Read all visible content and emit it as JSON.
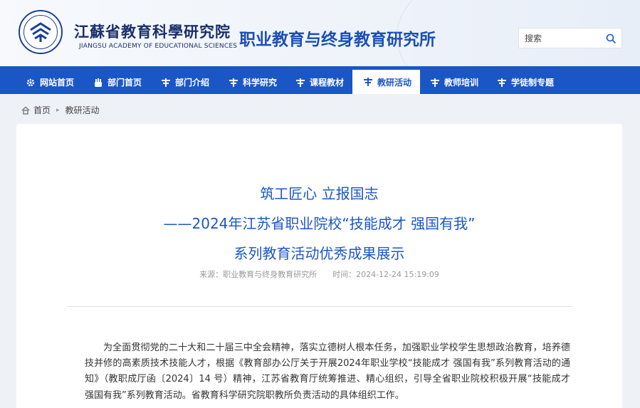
{
  "header": {
    "logo_cn": "江蘇省教育科學研究院",
    "logo_en": "JIANGSU ACADEMY OF EDUCATIONAL SCIENCES",
    "site_title": "职业教育与终身教育研究所",
    "search_placeholder": "搜索"
  },
  "nav": {
    "items": [
      {
        "label": "网站首页",
        "icon": "gear-icon"
      },
      {
        "label": "部门首页",
        "icon": "hand-icon"
      },
      {
        "label": "部门介绍",
        "icon": "tee-icon"
      },
      {
        "label": "科学研究",
        "icon": "tee-icon"
      },
      {
        "label": "课程教材",
        "icon": "tee-icon"
      },
      {
        "label": "教研活动",
        "icon": "tee-icon",
        "active": true
      },
      {
        "label": "教师培训",
        "icon": "tee-icon"
      },
      {
        "label": "学徒制专题",
        "icon": "tee-icon"
      }
    ]
  },
  "breadcrumb": {
    "home": "首页",
    "current": "教研活动"
  },
  "article": {
    "title_line1": "筑工匠心 立报国志",
    "title_line2": "——2024年江苏省职业院校“技能成才 强国有我”",
    "title_line3": "系列教育活动优秀成果展示",
    "source": "来源：职业教育与终身教育研究所",
    "time": "时间：2024-12-24 15:19:09",
    "paragraph": "为全面贯彻党的二十大和二十届三中全会精神，落实立德树人根本任务，加强职业学校学生思想政治教育，培养德技并修的高素质技术技能人才，根据《教育部办公厅关于开展2024年职业学校“技能成才 强国有我”系列教育活动的通知》（教职成厅函〔2024〕14 号）精神，江苏省教育厅统筹推进、精心组织，引导全省职业院校积极开展“技能成才 强国有我”系列教育活动。省教育科学研究院职教所负责活动的具体组织工作。"
  },
  "colors": {
    "brand_blue": "#1b56c6",
    "title_blue": "#1b4fb5",
    "logo_navy": "#1a2f6b"
  }
}
